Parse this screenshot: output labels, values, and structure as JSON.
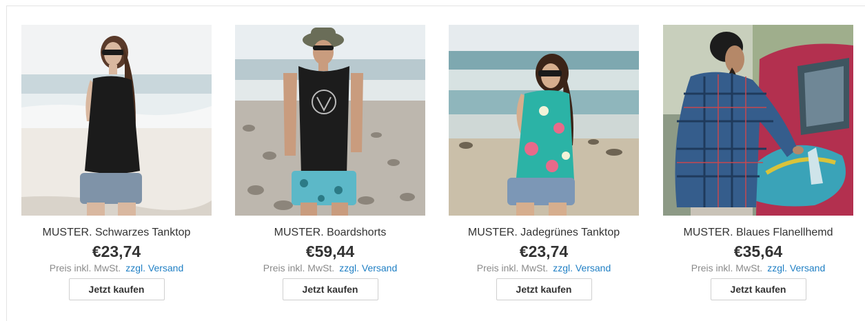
{
  "products": [
    {
      "title": "MUSTER. Schwarzes Tanktop",
      "price": "€23,74",
      "tax_note": "Preis inkl. MwSt.",
      "shipping_link": "zzgl. Versand",
      "buy_label": "Jetzt kaufen"
    },
    {
      "title": "MUSTER. Boardshorts",
      "price": "€59,44",
      "tax_note": "Preis inkl. MwSt.",
      "shipping_link": "zzgl. Versand",
      "buy_label": "Jetzt kaufen"
    },
    {
      "title": "MUSTER. Jadegrünes Tanktop",
      "price": "€23,74",
      "tax_note": "Preis inkl. MwSt.",
      "shipping_link": "zzgl. Versand",
      "buy_label": "Jetzt kaufen"
    },
    {
      "title": "MUSTER. Blaues Flanellhemd",
      "price": "€35,64",
      "tax_note": "Preis inkl. MwSt.",
      "shipping_link": "zzgl. Versand",
      "buy_label": "Jetzt kaufen"
    }
  ],
  "colors": {
    "link": "#1f7fc4",
    "text": "#333333",
    "muted": "#8a8a8a"
  }
}
